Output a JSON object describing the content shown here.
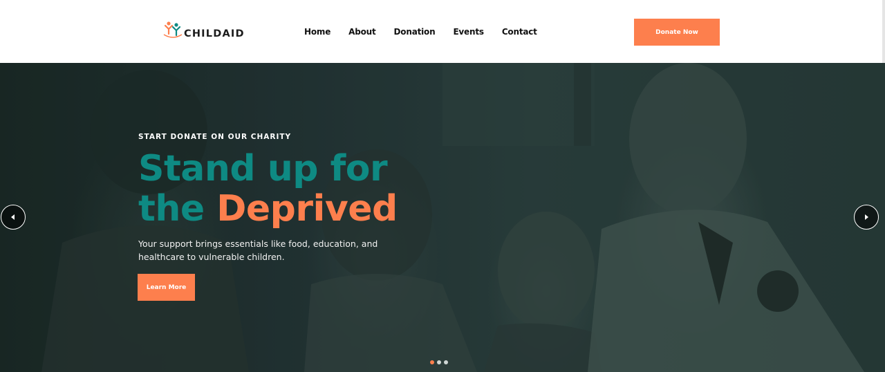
{
  "brand": {
    "name": "CHILDAID",
    "accent_color": "#fd7f4d",
    "teal_color": "#0e8a83"
  },
  "nav": {
    "items": [
      "Home",
      "About",
      "Donation",
      "Events",
      "Contact"
    ],
    "cta_label": "Donate Now"
  },
  "hero": {
    "kicker": "START DONATE ON OUR CHARITY",
    "headline_line1": "Stand up for",
    "headline_line2_prefix": "the ",
    "headline_line2_accent": "Deprived",
    "subtext": "Your support brings essentials like food, education, and healthcare to vulnerable children.",
    "button_label": "Learn More",
    "prev_icon": "chevron-left-icon",
    "next_icon": "chevron-right-icon",
    "slide_count": 3,
    "active_slide": 1
  }
}
